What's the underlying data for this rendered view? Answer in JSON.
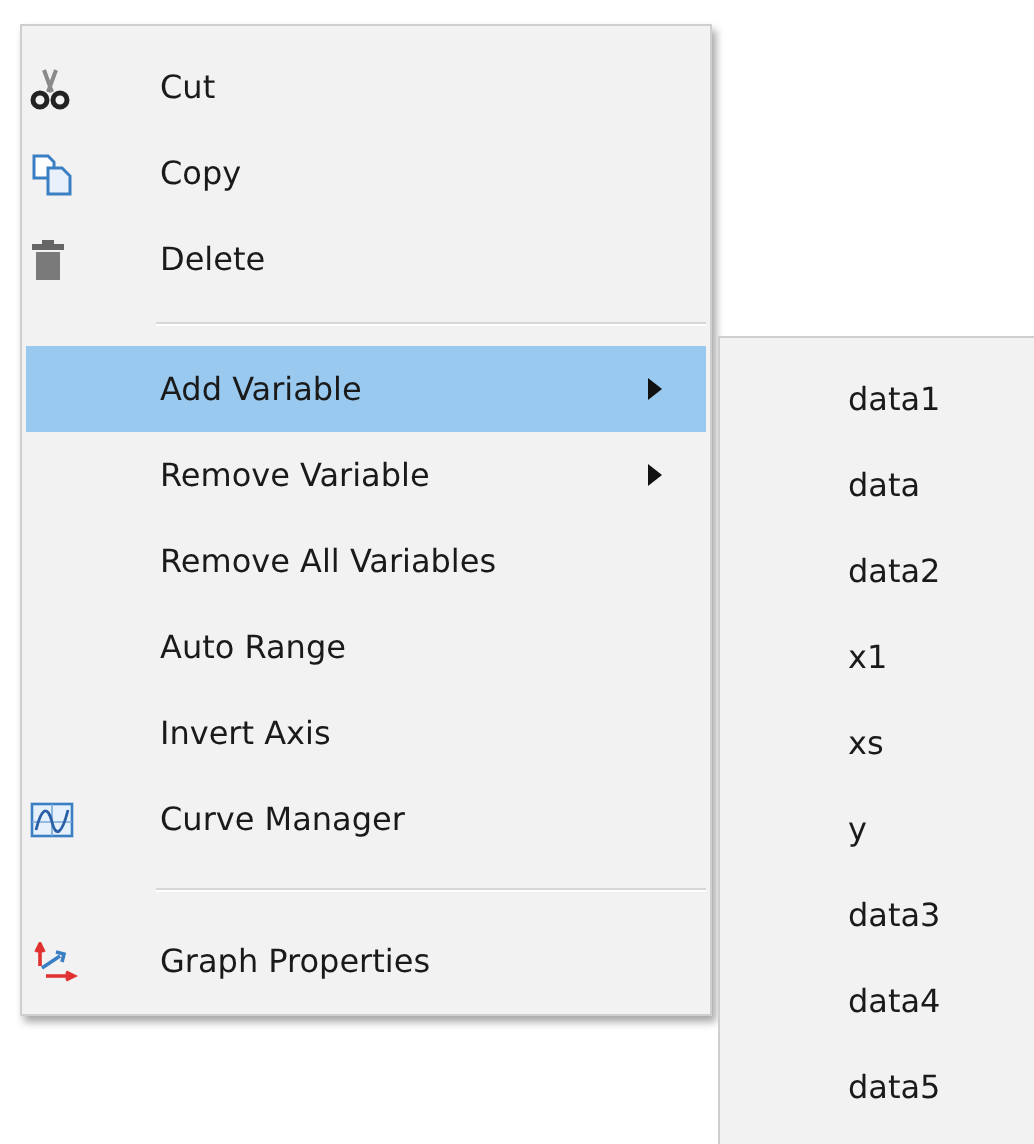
{
  "menu": {
    "items": [
      {
        "kind": "item",
        "label": "Cut",
        "selected": false,
        "submenu": false
      },
      {
        "kind": "item",
        "label": "Copy",
        "selected": false,
        "submenu": false
      },
      {
        "kind": "item",
        "label": "Delete",
        "selected": false,
        "submenu": false
      },
      {
        "kind": "separator"
      },
      {
        "kind": "item",
        "label": "Add Variable",
        "selected": true,
        "submenu": true
      },
      {
        "kind": "item",
        "label": "Remove Variable",
        "selected": false,
        "submenu": true
      },
      {
        "kind": "item",
        "label": "Remove All Variables",
        "selected": false,
        "submenu": false
      },
      {
        "kind": "item",
        "label": "Auto Range",
        "selected": false,
        "submenu": false
      },
      {
        "kind": "item",
        "label": "Invert Axis",
        "selected": false,
        "submenu": false
      },
      {
        "kind": "item",
        "label": "Curve Manager",
        "selected": false,
        "submenu": false
      },
      {
        "kind": "separator"
      },
      {
        "kind": "item",
        "label": "Graph Properties",
        "selected": false,
        "submenu": false
      }
    ]
  },
  "submenu": {
    "items": [
      "data1",
      "data",
      "data2",
      "x1",
      "xs",
      "y",
      "data3",
      "data4",
      "data5"
    ]
  }
}
